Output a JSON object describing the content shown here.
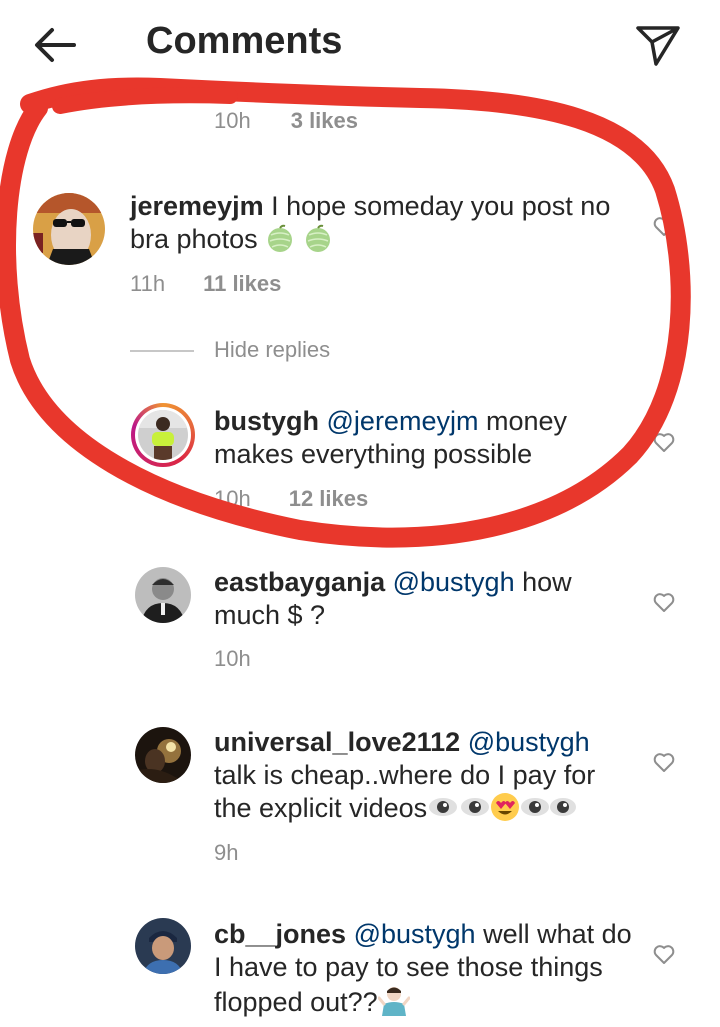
{
  "header": {
    "title": "Comments",
    "back_icon": "arrow-left-icon",
    "share_icon": "paper-plane-icon"
  },
  "partial_meta": {
    "time": "10h",
    "likes": "3 likes"
  },
  "hide_replies": "Hide replies",
  "comments": [
    {
      "username": "jeremeyjm",
      "text": "I hope someday you post no bra photos",
      "emoji": "melon-emoji",
      "time": "11h",
      "likes": "11 likes"
    },
    {
      "username": "bustygh",
      "mention": "@jeremeyjm",
      "text": "money makes everything possible",
      "time": "10h",
      "likes": "12 likes"
    },
    {
      "username": "eastbayganja",
      "mention": "@bustygh",
      "text": "how much $ ?",
      "time": "10h"
    },
    {
      "username": "universal_love2112",
      "mention": "@bustygh",
      "text": "talk is cheap..where do I pay for the explicit videos",
      "emoji": "eyes-heart-eyes-emoji",
      "time": "9h"
    },
    {
      "username": "cb__jones",
      "mention": "@bustygh",
      "text": "well what do I have to pay to see those things flopped out??",
      "emoji": "person-shrugging-emoji"
    }
  ],
  "colors": {
    "annotation_red": "#e8372c",
    "mention_blue": "#00376b",
    "meta_gray": "#8e8e8e",
    "story_ring_orange": "#f09433"
  }
}
